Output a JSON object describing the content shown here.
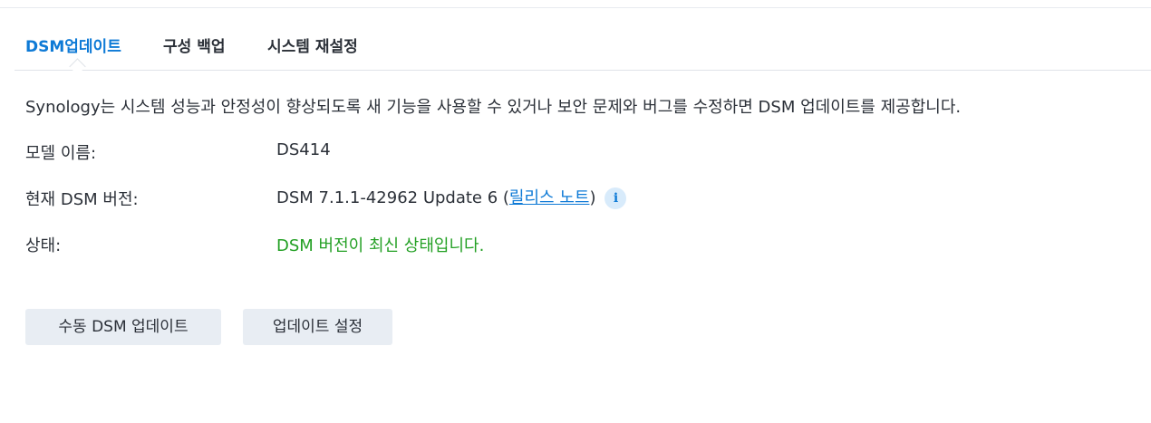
{
  "tabs": [
    {
      "label": "DSM업데이트",
      "active": true
    },
    {
      "label": "구성 백업",
      "active": false
    },
    {
      "label": "시스템 재설정",
      "active": false
    }
  ],
  "description": "Synology는 시스템 성능과 안정성이 향상되도록 새 기능을 사용할 수 있거나 보안 문제와 버그를 수정하면 DSM 업데이트를 제공합니다.",
  "info": {
    "model_label": "모델 이름:",
    "model_value": "DS414",
    "version_label": "현재 DSM 버전:",
    "version_value": "DSM 7.1.1-42962 Update 6 (",
    "release_notes_link": "릴리스 노트",
    "version_suffix": ")",
    "status_label": "상태:",
    "status_value": "DSM 버전이 최신 상태입니다."
  },
  "buttons": {
    "manual_update": "수동 DSM 업데이트",
    "update_settings": "업데이트 설정"
  },
  "colors": {
    "accent": "#0e7ad6",
    "status_ok": "#23a024",
    "button_bg": "#e8edf3",
    "info_icon_bg": "#d8ebfb"
  },
  "icons": {
    "info": "info-icon"
  }
}
